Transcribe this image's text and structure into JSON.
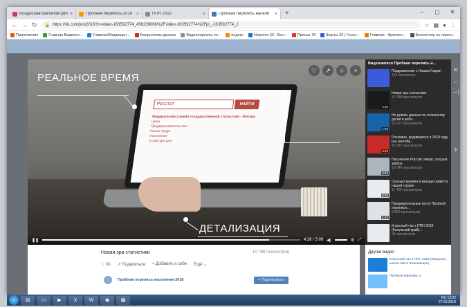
{
  "browser": {
    "tabs": [
      {
        "title": "Владислав Шелапов (@vladimir)",
        "color": "#d6336c"
      },
      {
        "title": "Пробная перепись 2018",
        "color": "#f59f00"
      },
      {
        "title": "ППН 2018",
        "color": "#868e96"
      },
      {
        "title": "Пробная перепись населе",
        "color": "#4a76a8"
      }
    ],
    "url": "https://vk.com/join2018?z=video-163592774_456239066%2Fvideo-163592774%2Fpl_-163592774_2",
    "bookmarks": [
      {
        "label": "Приложения",
        "color": "#e8590c"
      },
      {
        "label": "Главная Видеопо...",
        "color": "#2f9e44"
      },
      {
        "label": "Главная/Медиацен...",
        "color": "#1c7ed6"
      },
      {
        "label": "Ежедневник данные",
        "color": "#c92a2a"
      },
      {
        "label": "Видеопорталы по...",
        "color": "#868e96"
      },
      {
        "label": "индекс",
        "color": "#f08c00"
      },
      {
        "label": "Новости 33 · Все...",
        "color": "#1971c2"
      },
      {
        "label": "Пресса 78",
        "color": "#e03131"
      },
      {
        "label": "Шорты 33 | Госсл...",
        "color": "#3b5bdb"
      },
      {
        "label": "Главная · Архитек...",
        "color": "#e67700"
      },
      {
        "label": "Бюллетень по переп...",
        "color": "#495057"
      }
    ]
  },
  "video": {
    "label_realtime": "РЕАЛЬНОЕ ВРЕМЯ",
    "label_detail": "ДЕТАЛИЗАЦИЯ",
    "search_text": "Росстат",
    "search_button": "НАЙТИ",
    "screen_heading": "Федеральная служба государственной статистики - Москва",
    "screen_lines": [
      "Цена",
      "Предпринимательство",
      "Рынок труда",
      "Население",
      "Структура цен"
    ],
    "time": "4:26 / 5:09",
    "progress": 0.88,
    "title": "Новая эра статистики",
    "views": "10 788 просмотров",
    "likes": "30",
    "share": "Поделиться",
    "add": "Добавить к себе",
    "more": "Ещё",
    "author": "Пробная перепись населения 2018",
    "subscribe": "+ Подписаться"
  },
  "playlist": {
    "header": "Видеозаписи Пробная перепись н...",
    "items": [
      {
        "title": "Поздравление с Новым Годом!",
        "views": "152 просмотра",
        "duration": "",
        "color": "#3b5bdb"
      },
      {
        "title": "Новая эра статистики",
        "views": "10 788 просмотров",
        "duration": "5:09",
        "color": "#1a1a1a"
      },
      {
        "title": "Не делить данные по количеству детей в ребе...",
        "views": "10 027 просмотров",
        "duration": "1:03",
        "color": "#1864ab"
      },
      {
        "title": "Россияне, родившиеся в 2018 году (на сентябр...",
        "views": "10 087 просмотров",
        "duration": "0:45",
        "color": "#c92a2a"
      },
      {
        "title": "Население России: вчера, сегодня, завтра",
        "views": "10 046 просмотров",
        "duration": "0:59",
        "color": "#adb5bd"
      },
      {
        "title": "Сколько мужчин и женщин живет в нашей стране",
        "views": "11 400 просмотров",
        "duration": "0:52",
        "color": "#e9ecef"
      },
      {
        "title": "Предварительные итоги Пробной переписи...",
        "views": "9 800 просмотров",
        "duration": "1:27",
        "color": "#dee2e6"
      },
      {
        "title": "Классный час к ППН 2018 (Калужский край)...",
        "views": "95 просмотров",
        "duration": "",
        "color": "#e9ecef"
      }
    ]
  },
  "other": {
    "header": "Другие видео",
    "items": [
      {
        "title": "Классный час к ППН 2018 (Мищенок, школа №9 в Благовещен)",
        "color": "#1c7ed6"
      },
      {
        "title": "Пробная перепись 2",
        "color": "#74c0fc"
      }
    ]
  },
  "taskbar": {
    "time": "13:02",
    "date": "27.03.2019",
    "lang": "RU"
  }
}
